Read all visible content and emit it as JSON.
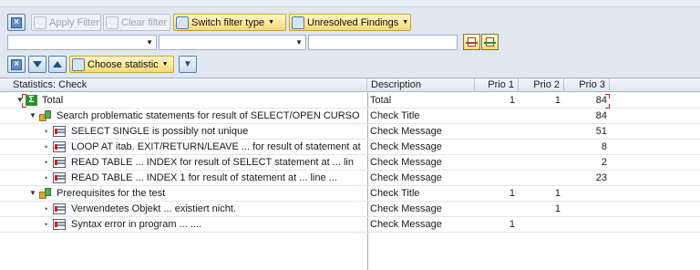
{
  "toolbar": {
    "apply_filter": "Apply Filter",
    "clear_filter": "Clear filter",
    "switch_filter_type": "Switch filter type",
    "unresolved_findings": "Unresolved Findings",
    "choose_statistic": "Choose statistic"
  },
  "columns": {
    "name": "Statistics: Check",
    "description": "Description",
    "prio1": "Prio 1",
    "prio2": "Prio 2",
    "prio3": "Prio 3"
  },
  "rows": [
    {
      "label": "Total",
      "description": "Total",
      "prio1": "1",
      "prio2": "1",
      "prio3": "84"
    },
    {
      "label": "Search problematic statements for result of SELECT/OPEN CURSO",
      "description": "Check Title",
      "prio1": "",
      "prio2": "",
      "prio3": "84"
    },
    {
      "label": "SELECT SINGLE is possibly not unique",
      "description": "Check Message",
      "prio1": "",
      "prio2": "",
      "prio3": "51"
    },
    {
      "label": "LOOP AT itab. EXIT/RETURN/LEAVE ... for result of statement at",
      "description": "Check Message",
      "prio1": "",
      "prio2": "",
      "prio3": "8"
    },
    {
      "label": "READ TABLE ... INDEX for result of SELECT statement at ... lin",
      "description": "Check Message",
      "prio1": "",
      "prio2": "",
      "prio3": "2"
    },
    {
      "label": "READ TABLE ... INDEX 1 for result of statement at ... line ...",
      "description": "Check Message",
      "prio1": "",
      "prio2": "",
      "prio3": "23"
    },
    {
      "label": "Prerequisites for the test",
      "description": "Check Title",
      "prio1": "1",
      "prio2": "1",
      "prio3": ""
    },
    {
      "label": "Verwendetes Objekt ... existiert nicht.",
      "description": "Check Message",
      "prio1": "",
      "prio2": "1",
      "prio3": ""
    },
    {
      "label": "Syntax error in program ... ....",
      "description": "Check Message",
      "prio1": "1",
      "prio2": "",
      "prio3": ""
    }
  ]
}
